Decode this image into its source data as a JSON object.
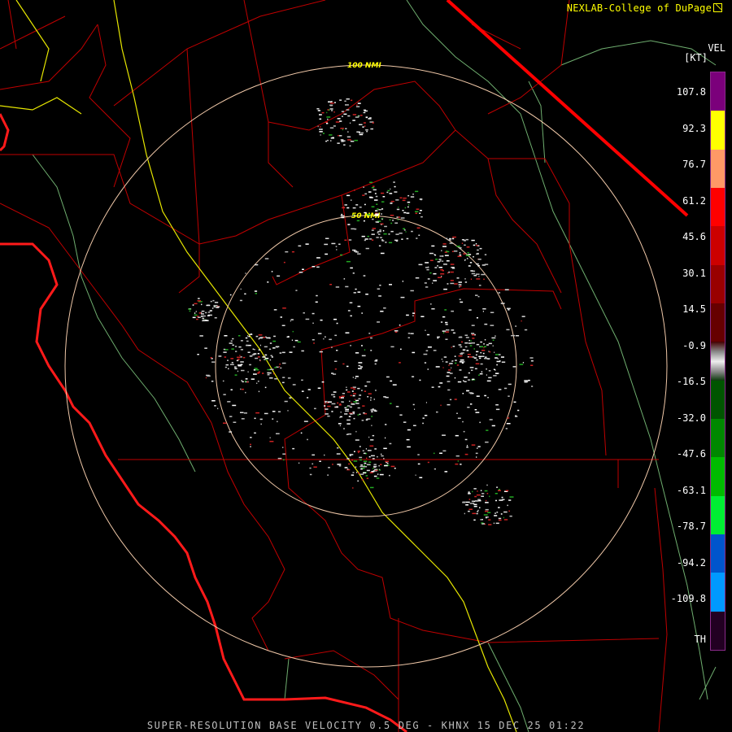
{
  "credit": {
    "text": "NEXLAB-College of DuPage",
    "logo_icon": "cod-logo-icon"
  },
  "legend": {
    "product": "VEL",
    "units": "[KT]",
    "labels": [
      "107.8",
      "92.3",
      "76.7",
      "61.2",
      "45.6",
      "30.1",
      "14.5",
      "-0.9",
      "-16.5",
      "-32.0",
      "-47.6",
      "-63.1",
      "-78.7",
      "-94.2",
      "-109.8",
      "TH"
    ],
    "colors": [
      "#7b007b",
      "#ffff00",
      "#ff9966",
      "#ff0000",
      "#cc0000",
      "#990000",
      "#660000",
      "#aaaaaa",
      "#005500",
      "#008800",
      "#00bb00",
      "#00ee33",
      "#0055cc",
      "#0099ff",
      "#220022"
    ]
  },
  "range_rings": {
    "inner_label": "50 NMI",
    "outer_label": "100 NMI"
  },
  "footer": {
    "text": "SUPER-RESOLUTION BASE VELOCITY 0.5 DEG - KHNX 15 DEC 25 01:22"
  },
  "colors": {
    "background": "#000000",
    "county_lines": "#c00000",
    "coastline": "#ff1a1a",
    "highway": "#e6e600",
    "rivers": "#7fbf7f",
    "range_ring": "#f0c8a8"
  }
}
